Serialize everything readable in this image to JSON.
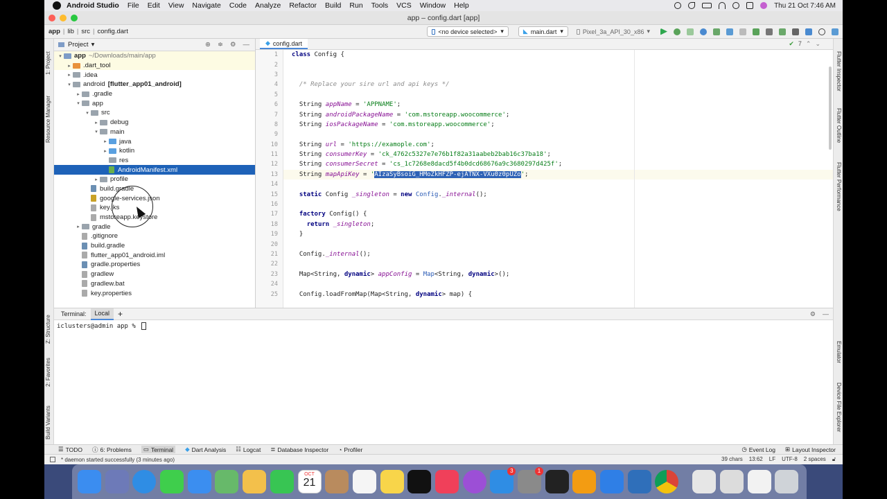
{
  "menubar": {
    "app": "Android Studio",
    "items": [
      "File",
      "Edit",
      "View",
      "Navigate",
      "Code",
      "Analyze",
      "Refactor",
      "Build",
      "Run",
      "Tools",
      "VCS",
      "Window",
      "Help"
    ],
    "clock": "Thu 21 Oct  7:46 AM"
  },
  "window": {
    "title": "app – config.dart [app]"
  },
  "navbar": {
    "crumbs": [
      "app",
      "lib",
      "src",
      "config.dart"
    ],
    "device": "<no device selected>",
    "run_config": "main.dart",
    "avd": "Pixel_3a_API_30_x86"
  },
  "project": {
    "header": "Project",
    "tree": [
      {
        "label": "app",
        "sub": "~/Downloads/main/app",
        "indent": 0,
        "arrow": "▾",
        "icon": "folder",
        "color": "#7e9cc7",
        "bold": true,
        "hl": true
      },
      {
        "label": ".dart_tool",
        "sub": "",
        "indent": 1,
        "arrow": "▸",
        "icon": "folder",
        "color": "#e8913a",
        "hl": true
      },
      {
        "label": ".idea",
        "sub": "",
        "indent": 1,
        "arrow": "▸",
        "icon": "folder",
        "color": "#9aa4ad"
      },
      {
        "label": "android",
        "sub": "[flutter_app01_android]",
        "indent": 1,
        "arrow": "▾",
        "icon": "folder",
        "color": "#9aa4ad",
        "subbold": true
      },
      {
        "label": ".gradle",
        "sub": "",
        "indent": 2,
        "arrow": "▸",
        "icon": "folder",
        "color": "#9aa4ad"
      },
      {
        "label": "app",
        "sub": "",
        "indent": 2,
        "arrow": "▾",
        "icon": "folder",
        "color": "#9aa4ad"
      },
      {
        "label": "src",
        "sub": "",
        "indent": 3,
        "arrow": "▾",
        "icon": "folder",
        "color": "#9aa4ad"
      },
      {
        "label": "debug",
        "sub": "",
        "indent": 4,
        "arrow": "▸",
        "icon": "folder",
        "color": "#9aa4ad"
      },
      {
        "label": "main",
        "sub": "",
        "indent": 4,
        "arrow": "▾",
        "icon": "folder",
        "color": "#9aa4ad"
      },
      {
        "label": "java",
        "sub": "",
        "indent": 5,
        "arrow": "▸",
        "icon": "folder",
        "color": "#5aa0e0"
      },
      {
        "label": "kotlin",
        "sub": "",
        "indent": 5,
        "arrow": "▸",
        "icon": "folder",
        "color": "#5aa0e0"
      },
      {
        "label": "res",
        "sub": "",
        "indent": 5,
        "arrow": "",
        "icon": "folder",
        "color": "#9aa4ad"
      },
      {
        "label": "AndroidManifest.xml",
        "sub": "",
        "indent": 5,
        "arrow": "",
        "icon": "file",
        "color": "#6ab04c",
        "sel": true
      },
      {
        "label": "profile",
        "sub": "",
        "indent": 4,
        "arrow": "▸",
        "icon": "folder",
        "color": "#9aa4ad"
      },
      {
        "label": "build.gradle",
        "sub": "",
        "indent": 3,
        "arrow": "",
        "icon": "file",
        "color": "#6b8fb3"
      },
      {
        "label": "google-services.json",
        "sub": "",
        "indent": 3,
        "arrow": "",
        "icon": "file",
        "color": "#c9a227"
      },
      {
        "label": "key.jks",
        "sub": "",
        "indent": 3,
        "arrow": "",
        "icon": "file",
        "color": "#aaaaaa"
      },
      {
        "label": "mstoreapp.keystore",
        "sub": "",
        "indent": 3,
        "arrow": "",
        "icon": "file",
        "color": "#aaaaaa"
      },
      {
        "label": "gradle",
        "sub": "",
        "indent": 2,
        "arrow": "▸",
        "icon": "folder",
        "color": "#9aa4ad"
      },
      {
        "label": ".gitignore",
        "sub": "",
        "indent": 2,
        "arrow": "",
        "icon": "file",
        "color": "#aaaaaa"
      },
      {
        "label": "build.gradle",
        "sub": "",
        "indent": 2,
        "arrow": "",
        "icon": "file",
        "color": "#6b8fb3"
      },
      {
        "label": "flutter_app01_android.iml",
        "sub": "",
        "indent": 2,
        "arrow": "",
        "icon": "file",
        "color": "#aaaaaa"
      },
      {
        "label": "gradle.properties",
        "sub": "",
        "indent": 2,
        "arrow": "",
        "icon": "file",
        "color": "#6b8fb3"
      },
      {
        "label": "gradlew",
        "sub": "",
        "indent": 2,
        "arrow": "",
        "icon": "file",
        "color": "#aaaaaa"
      },
      {
        "label": "gradlew.bat",
        "sub": "",
        "indent": 2,
        "arrow": "",
        "icon": "file",
        "color": "#aaaaaa"
      },
      {
        "label": "key.properties",
        "sub": "",
        "indent": 2,
        "arrow": "",
        "icon": "file",
        "color": "#aaaaaa"
      }
    ]
  },
  "editor": {
    "tab": "config.dart",
    "inspection": "7",
    "lines": [
      {
        "n": "1",
        "html": "<span class='kw'>class</span> Config {"
      },
      {
        "n": "2",
        "html": ""
      },
      {
        "n": "3",
        "html": ""
      },
      {
        "n": "4",
        "html": "  <span class='cm'>/* Replace your sire url and api keys */</span>"
      },
      {
        "n": "5",
        "html": ""
      },
      {
        "n": "6",
        "html": "  String <span class='fld'>appName</span> = <span class='str'>'APPNAME'</span>;"
      },
      {
        "n": "7",
        "html": "  String <span class='fld'>androidPackageName</span> = <span class='str'>'com.mstoreapp.woocommerce'</span>;"
      },
      {
        "n": "8",
        "html": "  String <span class='fld'>iosPackageName</span> = <span class='str'>'com.mstoreapp.woocommerce'</span>;"
      },
      {
        "n": "9",
        "html": ""
      },
      {
        "n": "10",
        "html": "  String <span class='fld'>url</span> = <span class='str'>'https://examople.com'</span>;"
      },
      {
        "n": "11",
        "html": "  String <span class='fld'>consumerKey</span> = <span class='str'>'ck_4762c5327e7e76b1f82a31aabeb2bab16c37ba18'</span>;"
      },
      {
        "n": "12",
        "html": "  String <span class='fld'>consumerSecret</span> = <span class='str'>'cs_1c7268e8dacd5f4b0dcd68676a9c3680297d425f'</span>;"
      },
      {
        "n": "13",
        "html": "  String <span class='fld'>mapApiKey</span> = <span class='str'>'<span class='selx'>AIzaSyBsoiG_HMoZkHFZP-ejATNX-VXu0z0pUZo</span>'</span>;",
        "cur": true
      },
      {
        "n": "14",
        "html": ""
      },
      {
        "n": "15",
        "html": "  <span class='kw'>static</span> Config <span class='fld'>_singleton</span> = <span class='kw'>new</span> <span class='typ'>Config</span>.<span class='fld'>_internal</span>();"
      },
      {
        "n": "16",
        "html": ""
      },
      {
        "n": "17",
        "html": "  <span class='kw'>factory</span> Config() {"
      },
      {
        "n": "18",
        "html": "    <span class='kw'>return</span> <span class='fld'>_singleton</span>;"
      },
      {
        "n": "19",
        "html": "  }"
      },
      {
        "n": "20",
        "html": ""
      },
      {
        "n": "21",
        "html": "  Config.<span class='fld'>_internal</span>();"
      },
      {
        "n": "22",
        "html": ""
      },
      {
        "n": "23",
        "html": "  Map&lt;String, <span class='kw'>dynamic</span>&gt; <span class='fld'>appConfig</span> = <span class='typ'>Map</span>&lt;String, <span class='kw'>dynamic</span>&gt;();"
      },
      {
        "n": "24",
        "html": ""
      },
      {
        "n": "25",
        "html": "  Config.loadFromMap(Map&lt;String, <span class='kw'>dynamic</span>&gt; map) {"
      }
    ]
  },
  "terminal": {
    "label": "Terminal:",
    "tab": "Local",
    "prompt": "iclusters@admin app % "
  },
  "bottom_tools": [
    "TODO",
    "6: Problems",
    "Terminal",
    "Dart Analysis",
    "Logcat",
    "Database Inspector",
    "Profiler"
  ],
  "bottom_right": [
    "Event Log",
    "Layout Inspector"
  ],
  "status": {
    "message": "* daemon started successfully (3 minutes ago)",
    "chars": "39 chars",
    "pos": "13:62",
    "lf": "LF",
    "enc": "UTF-8",
    "indent": "2 spaces"
  },
  "left_tabs": [
    "1: Project",
    "Resource Manager",
    "Z: Structure",
    "2: Favorites",
    "Build Variants"
  ],
  "right_tabs": [
    "Flutter Inspector",
    "Flutter Outline",
    "Flutter Performance",
    "Emulator",
    "Device File Explorer"
  ],
  "dock": {
    "calendar_month": "OCT",
    "calendar_day": "21",
    "badge_appstore": "3",
    "badge_settings": "1",
    "apps": [
      {
        "name": "finder-icon",
        "color": "#3b8df0"
      },
      {
        "name": "launchpad-icon",
        "color": "#6d7ab8"
      },
      {
        "name": "safari-icon",
        "color": "#2f8de4"
      },
      {
        "name": "messages-icon",
        "color": "#3fce4c"
      },
      {
        "name": "mail-icon",
        "color": "#3b8ef0"
      },
      {
        "name": "maps-icon",
        "color": "#67b96a"
      },
      {
        "name": "photos-icon",
        "color": "#f3c04b"
      },
      {
        "name": "facetime-icon",
        "color": "#38c553"
      },
      {
        "name": "calendar-icon",
        "color": "#ffffff"
      },
      {
        "name": "contacts-icon",
        "color": "#b98b5e"
      },
      {
        "name": "reminders-icon",
        "color": "#f5f5f5"
      },
      {
        "name": "notes-icon",
        "color": "#f8d54a"
      },
      {
        "name": "appletv-icon",
        "color": "#111111"
      },
      {
        "name": "music-icon",
        "color": "#f0405a"
      },
      {
        "name": "podcasts-icon",
        "color": "#9c4fd6"
      },
      {
        "name": "appstore-icon",
        "color": "#2f8de4"
      },
      {
        "name": "systemprefs-icon",
        "color": "#8a8a8a"
      },
      {
        "name": "terminal-icon",
        "color": "#222222"
      },
      {
        "name": "sublime-icon",
        "color": "#f39c12"
      },
      {
        "name": "xcode-icon",
        "color": "#2f7fe6"
      },
      {
        "name": "androidstudio-icon",
        "color": "#2f6fba"
      },
      {
        "name": "chrome-icon",
        "color": "#e8c94a"
      },
      {
        "name": "document-icon",
        "color": "#e6e6e6"
      },
      {
        "name": "preview-icon",
        "color": "#dcdcdc"
      },
      {
        "name": "screenshot-icon",
        "color": "#f2f2f2"
      },
      {
        "name": "trash-icon",
        "color": "#cfd3d8"
      }
    ]
  }
}
